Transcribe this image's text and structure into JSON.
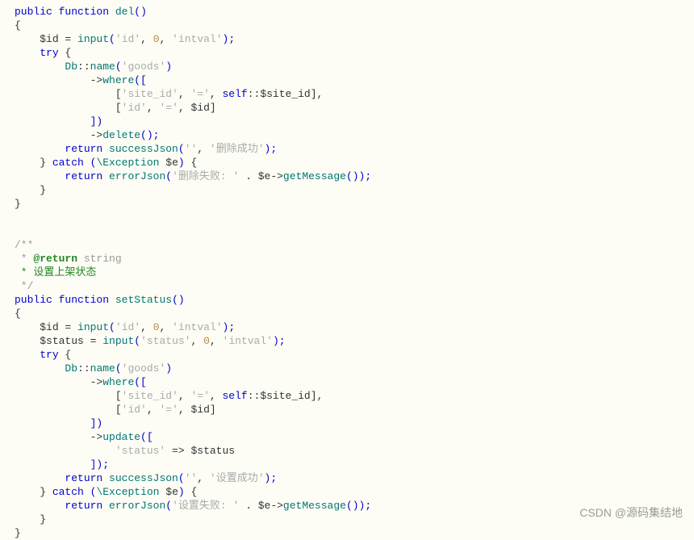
{
  "code": {
    "fn1": {
      "decl_public": "public",
      "decl_function": "function",
      "name": "del",
      "parens": "()",
      "brace_open": "{",
      "line_id_var": "$id",
      "line_id_eq": " = ",
      "line_id_fn": "input",
      "line_id_args_open": "(",
      "line_id_arg1": "'id'",
      "line_id_comma1": ", ",
      "line_id_arg2": "0",
      "line_id_comma2": ", ",
      "line_id_arg3": "'intval'",
      "line_id_args_close": ");",
      "try_kw": "try",
      "try_brace": " {",
      "db_class": "Db",
      "db_scope": "::",
      "db_name": "name",
      "db_name_open": "(",
      "db_name_arg": "'goods'",
      "db_name_close": ")",
      "arrow1": "->",
      "where_fn": "where",
      "where_open": "([",
      "where_row1_open": "[",
      "where_row1_f1": "'site_id'",
      "where_row1_c1": ", ",
      "where_row1_f2": "'='",
      "where_row1_c2": ", ",
      "where_row1_selfkw": "self",
      "where_row1_scope": "::",
      "where_row1_var": "$site_id",
      "where_row1_close": "],",
      "where_row2_open": "[",
      "where_row2_f1": "'id'",
      "where_row2_c1": ", ",
      "where_row2_f2": "'='",
      "where_row2_c2": ", ",
      "where_row2_var": "$id",
      "where_row2_close": "]",
      "where_close": "])",
      "arrow2": "->",
      "delete_fn": "delete",
      "delete_call": "();",
      "return1_kw": "return",
      "return1_sp": " ",
      "return1_fn": "successJson",
      "return1_open": "(",
      "return1_a1": "''",
      "return1_c1": ", ",
      "return1_a2": "'删除成功'",
      "return1_close": ");",
      "catch_close_try": "}",
      "catch_kw": " catch ",
      "catch_open": "(",
      "catch_exc": "\\Exception",
      "catch_sp": " ",
      "catch_var": "$e",
      "catch_close_paren": ")",
      "catch_brace": " {",
      "return2_kw": "return",
      "return2_sp": " ",
      "return2_fn": "errorJson",
      "return2_open": "(",
      "return2_a1": "'删除失败: '",
      "return2_c1": " . ",
      "return2_var": "$e",
      "return2_arrow": "->",
      "return2_gm": "getMessage",
      "return2_gm_call": "());",
      "catch_close": "}",
      "brace_close": "}"
    },
    "docblock": {
      "open": "/**",
      "line1_star": " * ",
      "line1_tag": "@return",
      "line1_rest": " string",
      "line2": " * 设置上架状态",
      "close": " */"
    },
    "fn2": {
      "decl_public": "public",
      "decl_function": "function",
      "name": "setStatus",
      "parens": "()",
      "brace_open": "{",
      "id_var": "$id",
      "id_eq": " = ",
      "id_fn": "input",
      "id_open": "(",
      "id_a1": "'id'",
      "id_c1": ", ",
      "id_a2": "0",
      "id_c2": ", ",
      "id_a3": "'intval'",
      "id_close": ");",
      "st_var": "$status",
      "st_eq": " = ",
      "st_fn": "input",
      "st_open": "(",
      "st_a1": "'status'",
      "st_c1": ", ",
      "st_a2": "0",
      "st_c2": ", ",
      "st_a3": "'intval'",
      "st_close": ");",
      "try_kw": "try",
      "try_brace": " {",
      "db_class": "Db",
      "db_scope": "::",
      "db_name": "name",
      "db_name_open": "(",
      "db_name_arg": "'goods'",
      "db_name_close": ")",
      "arrow1": "->",
      "where_fn": "where",
      "where_open": "([",
      "where_row1_open": "[",
      "where_row1_f1": "'site_id'",
      "where_row1_c1": ", ",
      "where_row1_f2": "'='",
      "where_row1_c2": ", ",
      "where_row1_selfkw": "self",
      "where_row1_scope": "::",
      "where_row1_var": "$site_id",
      "where_row1_close": "],",
      "where_row2_open": "[",
      "where_row2_f1": "'id'",
      "where_row2_c1": ", ",
      "where_row2_f2": "'='",
      "where_row2_c2": ", ",
      "where_row2_var": "$id",
      "where_row2_close": "]",
      "where_close": "])",
      "arrow2": "->",
      "update_fn": "update",
      "update_open": "([",
      "update_key": "'status'",
      "update_arrow": " => ",
      "update_val": "$status",
      "update_close": "]);",
      "return1_kw": "return",
      "return1_sp": " ",
      "return1_fn": "successJson",
      "return1_open": "(",
      "return1_a1": "''",
      "return1_c1": ", ",
      "return1_a2": "'设置成功'",
      "return1_close": ");",
      "catch_close_try": "}",
      "catch_kw": " catch ",
      "catch_open": "(",
      "catch_exc": "\\Exception",
      "catch_sp": " ",
      "catch_var": "$e",
      "catch_close_paren": ")",
      "catch_brace": " {",
      "return2_kw": "return",
      "return2_sp": " ",
      "return2_fn": "errorJson",
      "return2_open": "(",
      "return2_a1": "'设置失败: '",
      "return2_c1": " . ",
      "return2_var": "$e",
      "return2_arrow": "->",
      "return2_gm": "getMessage",
      "return2_gm_call": "());",
      "catch_close": "}",
      "brace_close": "}"
    }
  },
  "watermark": "CSDN @源码集结地"
}
